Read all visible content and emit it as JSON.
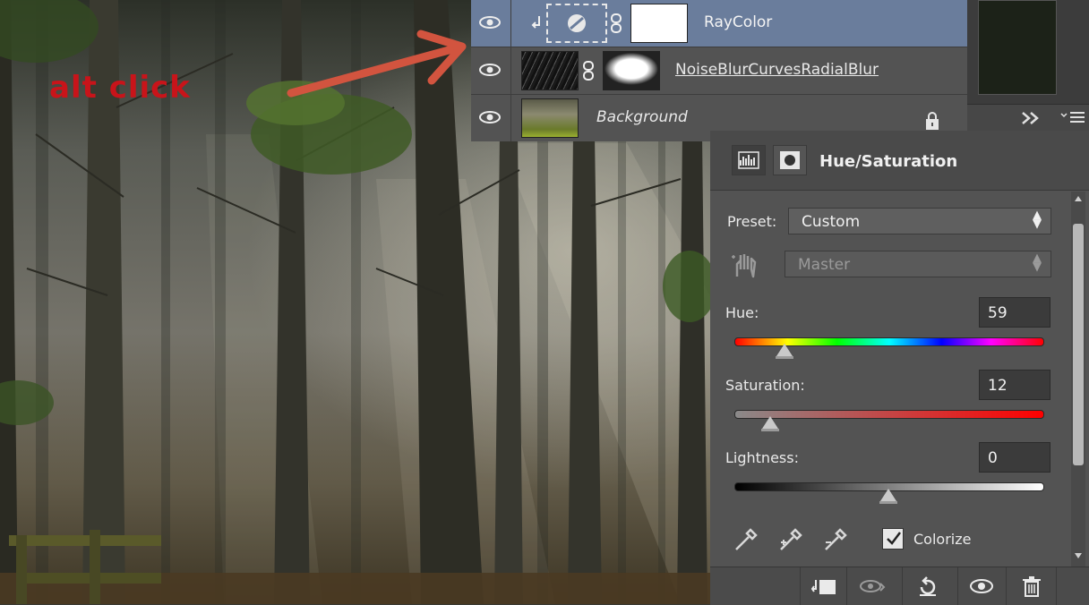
{
  "annotation": {
    "text": "alt click",
    "color": "#c8141a"
  },
  "layers": {
    "rows": [
      {
        "name": "RayColor",
        "selected": true
      },
      {
        "name": "NoiseBlurCurvesRadialBlur",
        "selected": false
      },
      {
        "name": "Background",
        "selected": false,
        "locked": true
      }
    ]
  },
  "properties": {
    "title": "Hue/Saturation",
    "preset_label": "Preset:",
    "preset_value": "Custom",
    "channel_value": "Master",
    "hue": {
      "label": "Hue:",
      "value": "59",
      "position": 0.16
    },
    "saturation": {
      "label": "Saturation:",
      "value": "12",
      "position": 0.11
    },
    "lightness": {
      "label": "Lightness:",
      "value": "0",
      "position": 0.5
    },
    "colorize": {
      "label": "Colorize",
      "checked": true
    }
  },
  "colors": {
    "selected_layer": "#6a7d9c",
    "panel": "#535353",
    "arrow": "#d2543f"
  }
}
